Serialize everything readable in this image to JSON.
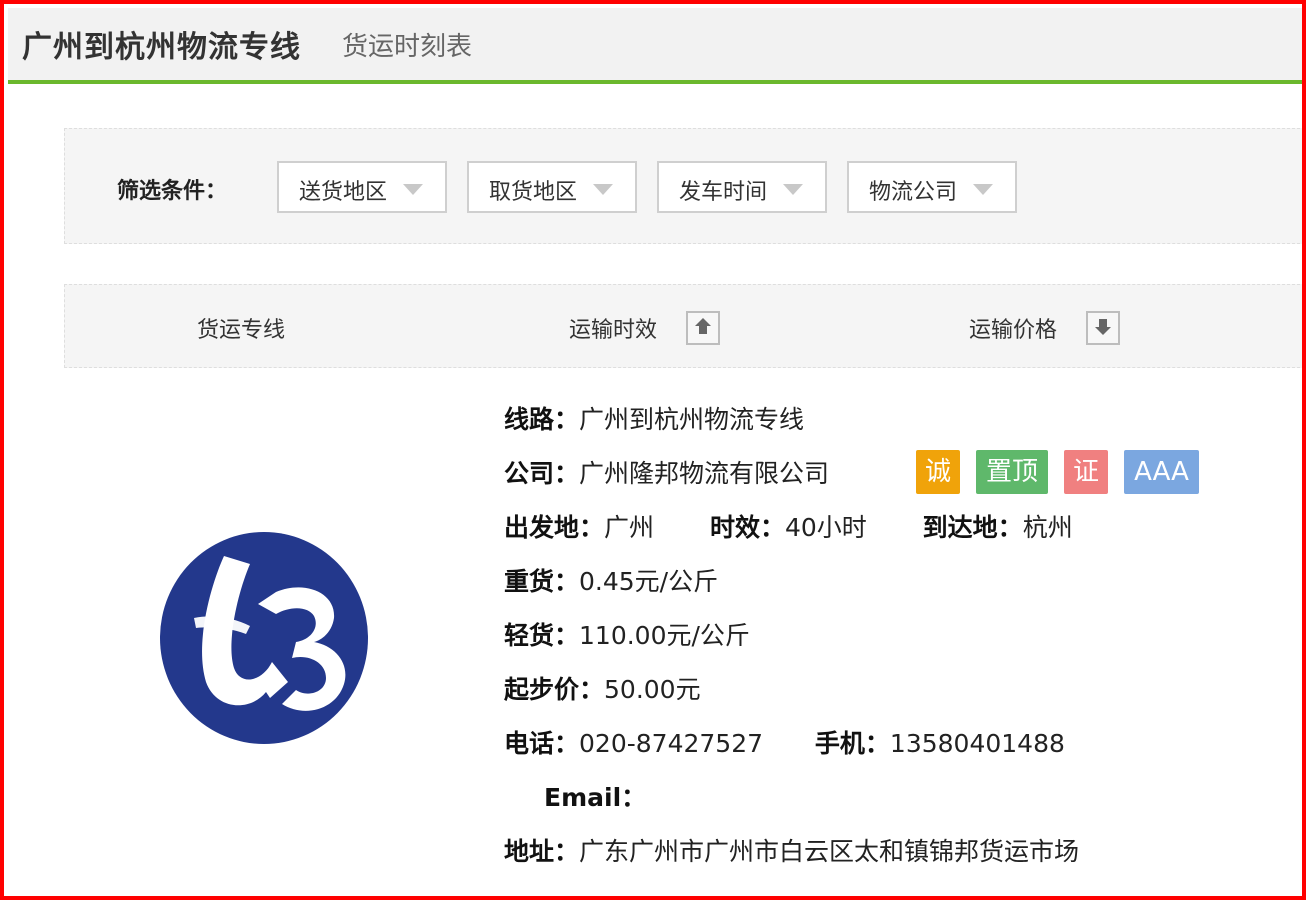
{
  "header": {
    "title": "广州到杭州物流专线",
    "subtitle": "货运时刻表",
    "accent_color": "#6bb82d"
  },
  "filters": {
    "label": "筛选条件：",
    "items": [
      {
        "label": "送货地区"
      },
      {
        "label": "取货地区"
      },
      {
        "label": "发车时间"
      },
      {
        "label": "物流公司"
      }
    ]
  },
  "sort_header": {
    "col_route": "货运专线",
    "col_time": "运输时效",
    "col_price": "运输价格",
    "time_sort_icon": "sort-up-icon",
    "price_sort_icon": "sort-down-icon"
  },
  "listing": {
    "logo_icon": "company-logo-ub",
    "route_label": "线路：",
    "route_value": "广州到杭州物流专线",
    "company_label": "公司：",
    "company_value": "广州隆邦物流有限公司",
    "badges": [
      {
        "text": "诚",
        "color": "#f0a30a"
      },
      {
        "text": "置顶",
        "color": "#5fb86b"
      },
      {
        "text": "证",
        "color": "#f08080"
      },
      {
        "text": "AAA",
        "color": "#7ba7e0"
      }
    ],
    "origin_label": "出发地：",
    "origin_value": "广州",
    "duration_label": "时效：",
    "duration_value": "40小时",
    "destination_label": "到达地：",
    "destination_value": "杭州",
    "heavy_label": "重货：",
    "heavy_value": "0.45元/公斤",
    "light_label": "轻货：",
    "light_value": "110.00元/公斤",
    "min_label": "起步价：",
    "min_value": "50.00元",
    "phone_label": "电话：",
    "phone_value": "020-87427527",
    "mobile_label": "手机：",
    "mobile_value": "13580401488",
    "email_label": "Email：",
    "email_value": "",
    "address_label": "地址：",
    "address_value": "广东广州市广州市白云区太和镇锦邦货运市场"
  }
}
